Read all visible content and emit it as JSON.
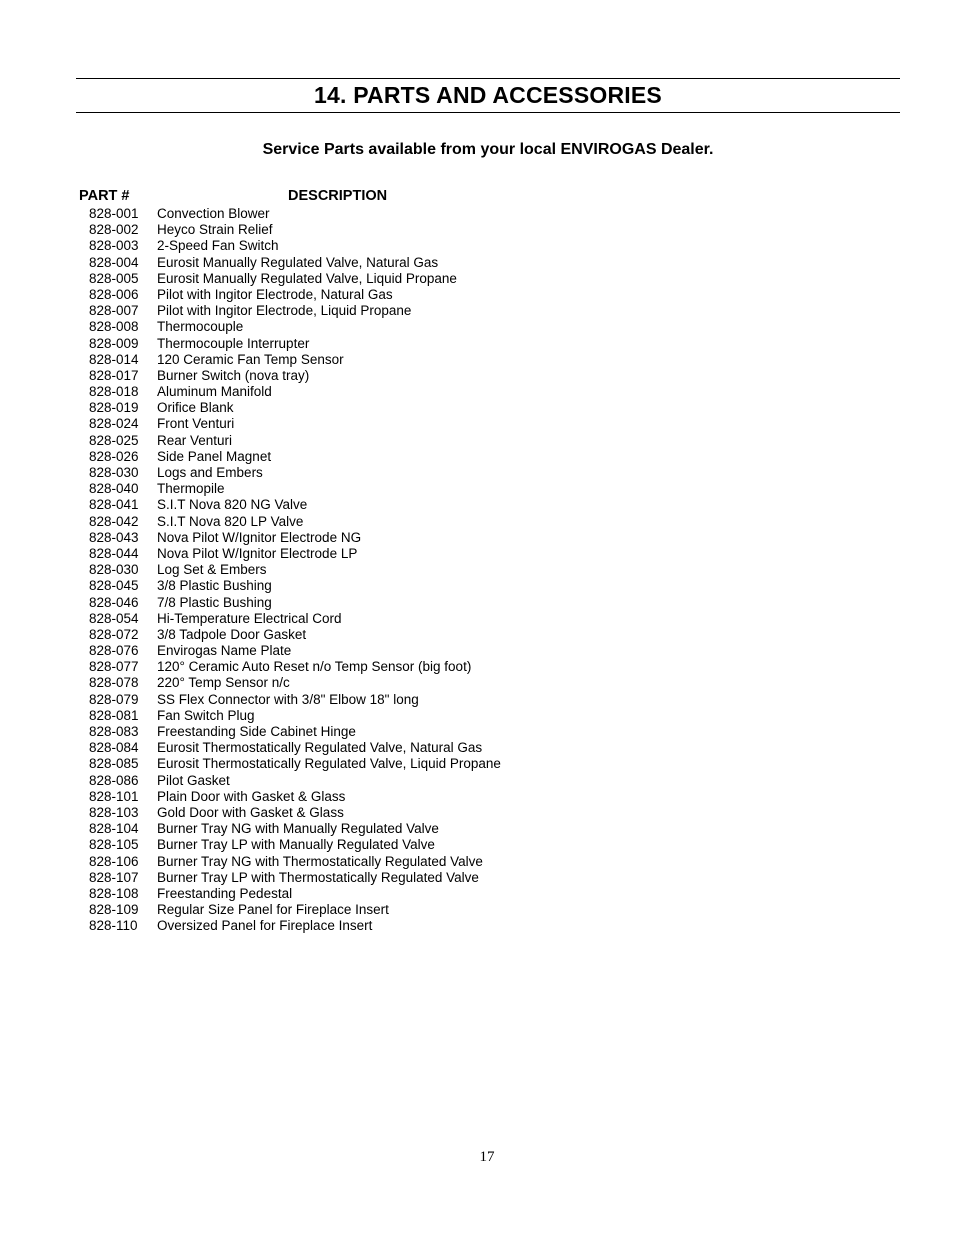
{
  "section_title": "14. PARTS AND ACCESSORIES",
  "subtitle": "Service Parts available from your local ENVIROGAS Dealer.",
  "table": {
    "headers": {
      "part": "PART #",
      "description": "DESCRIPTION"
    },
    "rows": [
      {
        "part": "828-001",
        "description": "Convection Blower"
      },
      {
        "part": "828-002",
        "description": "Heyco Strain Relief"
      },
      {
        "part": "828-003",
        "description": "2-Speed Fan Switch"
      },
      {
        "part": "828-004",
        "description": "Eurosit Manually Regulated Valve, Natural Gas"
      },
      {
        "part": "828-005",
        "description": "Eurosit Manually Regulated Valve, Liquid Propane"
      },
      {
        "part": "828-006",
        "description": "Pilot with Ingitor Electrode, Natural Gas"
      },
      {
        "part": "828-007",
        "description": "Pilot with Ingitor Electrode, Liquid Propane"
      },
      {
        "part": "828-008",
        "description": "Thermocouple"
      },
      {
        "part": "828-009",
        "description": "Thermocouple Interrupter"
      },
      {
        "part": "828-014",
        "description": "120 Ceramic Fan Temp Sensor"
      },
      {
        "part": "828-017",
        "description": "Burner Switch (nova tray)"
      },
      {
        "part": "828-018",
        "description": "Aluminum Manifold"
      },
      {
        "part": "828-019",
        "description": "Orifice Blank"
      },
      {
        "part": "828-024",
        "description": "Front Venturi"
      },
      {
        "part": "828-025",
        "description": "Rear Venturi"
      },
      {
        "part": "828-026",
        "description": "Side Panel Magnet"
      },
      {
        "part": "828-030",
        "description": "Logs and Embers"
      },
      {
        "part": "828-040",
        "description": "Thermopile"
      },
      {
        "part": "828-041",
        "description": "S.I.T Nova 820 NG Valve"
      },
      {
        "part": "828-042",
        "description": "S.I.T Nova 820 LP Valve"
      },
      {
        "part": "828-043",
        "description": "Nova Pilot W/Ignitor Electrode NG"
      },
      {
        "part": "828-044",
        "description": "Nova Pilot W/Ignitor Electrode LP"
      },
      {
        "part": "828-030",
        "description": "Log Set & Embers"
      },
      {
        "part": "828-045",
        "description": "3/8 Plastic Bushing"
      },
      {
        "part": "828-046",
        "description": "7/8 Plastic Bushing"
      },
      {
        "part": "828-054",
        "description": "Hi-Temperature Electrical Cord"
      },
      {
        "part": "828-072",
        "description": "3/8 Tadpole Door Gasket"
      },
      {
        "part": "828-076",
        "description": "Envirogas Name Plate"
      },
      {
        "part": "828-077",
        "description": "120° Ceramic Auto Reset n/o Temp Sensor (big foot)"
      },
      {
        "part": "828-078",
        "description": "220° Temp Sensor n/c"
      },
      {
        "part": "828-079",
        "description": "SS Flex Connector with 3/8\" Elbow 18\" long"
      },
      {
        "part": "828-081",
        "description": "Fan Switch Plug"
      },
      {
        "part": "828-083",
        "description": "Freestanding Side Cabinet Hinge"
      },
      {
        "part": "828-084",
        "description": "Eurosit Thermostatically Regulated Valve, Natural Gas"
      },
      {
        "part": "828-085",
        "description": "Eurosit Thermostatically Regulated Valve, Liquid Propane"
      },
      {
        "part": "828-086",
        "description": "Pilot Gasket"
      },
      {
        "part": "828-101",
        "description": "Plain Door with Gasket & Glass"
      },
      {
        "part": "828-103",
        "description": "Gold Door with Gasket & Glass"
      },
      {
        "part": "828-104",
        "description": "Burner Tray NG with Manually Regulated Valve"
      },
      {
        "part": "828-105",
        "description": "Burner Tray LP with Manually Regulated Valve"
      },
      {
        "part": "828-106",
        "description": "Burner Tray NG with Thermostatically Regulated Valve"
      },
      {
        "part": "828-107",
        "description": "Burner Tray LP with Thermostatically Regulated Valve"
      },
      {
        "part": "828-108",
        "description": "Freestanding Pedestal"
      },
      {
        "part": "828-109",
        "description": "Regular Size Panel for Fireplace Insert"
      },
      {
        "part": "828-110",
        "description": "Oversized Panel for Fireplace Insert"
      }
    ]
  },
  "page_number": "17"
}
